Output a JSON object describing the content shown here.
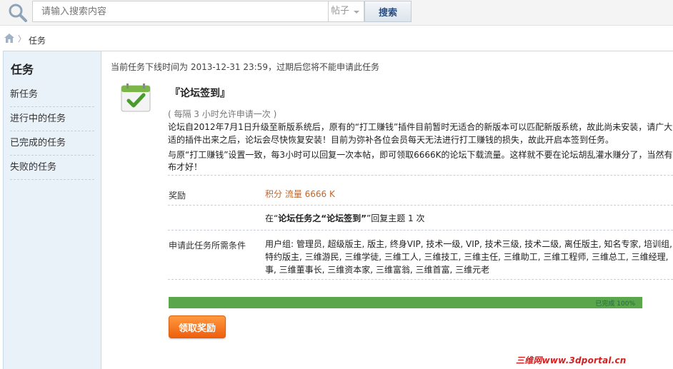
{
  "search": {
    "placeholder": "请输入搜索内容",
    "type": "帖子",
    "button": "搜索"
  },
  "breadcrumb": {
    "current": "任务",
    "separator": "〉"
  },
  "sidebar": {
    "title": "任务",
    "items": [
      {
        "label": "新任务"
      },
      {
        "label": "进行中的任务"
      },
      {
        "label": "已完成的任务"
      },
      {
        "label": "失败的任务"
      }
    ]
  },
  "task": {
    "deadline": "当前任务下线时间为 2013-12-31 23:59，过期后您将不能申请此任务",
    "title": "『论坛签到』",
    "period": "( 每隔 3 小时允许申请一次 )",
    "description_lines": [
      "论坛自2012年7月1日升级至新版系统后，原有的“打工赚钱”插件目前暂时无适合的新版本可以匹配新版系统，故此尚未安装，请广大会",
      "适的插件出来之后，论坛会尽快恢复安装！目前为弥补各位会员每天无法进行打工赚钱的损失，故此开启本签到任务。",
      "与原“打工赚钱”设置一致，每3小时可以回复一次本帖，即可领取6666K的论坛下载流量。这样就不要在论坛胡乱灌水赚分了，当然有用",
      "布才好！"
    ],
    "reward_label": "奖励",
    "reward_value": "积分 流量 6666 K",
    "condition": {
      "prefix": "在“",
      "bold": "论坛任务之“论坛签到”",
      "suffix": "”回复主题 1 次"
    },
    "requirements_label": "申请此任务所需条件",
    "group_lines": [
      "用户组: 管理员, 超级版主, 版主, 终身VIP, 技术一级, VIP, 技术三级, 技术二级, 离任版主, 知名专家, 培训组,",
      "特约版主, 三维游民, 三维学徒, 三维工人, 三维技工, 三维主任, 三维助工, 三维工程师, 三维总工, 三维经理,",
      "事, 三维董事长, 三维资本家, 三维富翁, 三维首富, 三维元老"
    ],
    "progress_text": "已完成 100%",
    "progress_value": 100,
    "claim_button": "领取奖励"
  },
  "watermark": "三维网www.3dportal.cn",
  "colors": {
    "progress": "#5aa64a",
    "reward": "#c0652a",
    "claim_button": "#f07a24",
    "sidebar_bg": "#e9f1f9"
  }
}
